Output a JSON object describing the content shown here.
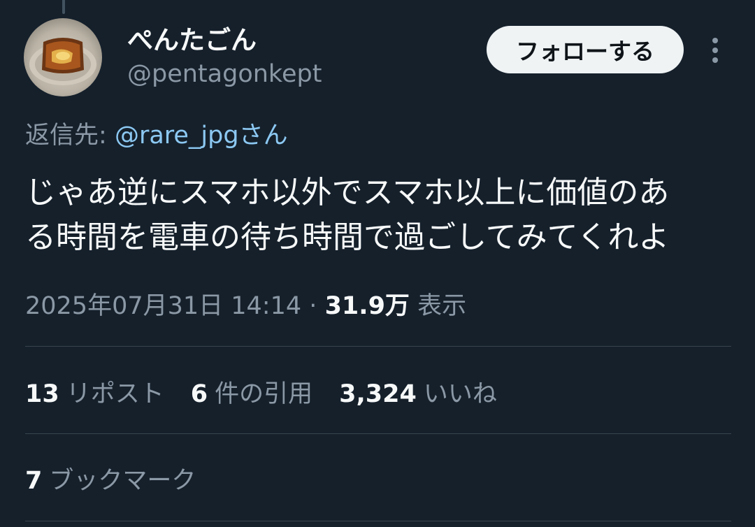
{
  "tweet": {
    "author": {
      "display_name": "ぺんたごん",
      "handle": "@pentagonkept",
      "avatar_icon": "toast-avatar-icon"
    },
    "follow_label": "フォローする",
    "more_icon": "more-vertical-icon",
    "reply_prefix": "返信先:",
    "reply_mention": "@rare_jpgさん",
    "text_lines": [
      "じゃあ逆にスマホ以外でスマホ以上に価値のあ",
      "る時間を電車の待ち時間で過ごしてみてくれよ"
    ],
    "date": "2025年07月31日 14:14",
    "separator": "·",
    "views_count": "31.9万",
    "views_label": "表示",
    "stats": {
      "reposts": {
        "count": "13",
        "label": "リポスト"
      },
      "quotes": {
        "count": "6",
        "label": "件の引用"
      },
      "likes": {
        "count": "3,324",
        "label": "いいね"
      }
    },
    "bookmarks": {
      "count": "7",
      "label": "ブックマーク"
    }
  },
  "colors": {
    "background": "#15202b",
    "primary_text": "#f7f9f9",
    "secondary_text": "#8b98a5",
    "link": "#8cc8f2",
    "divider": "#38444d",
    "follow_button_bg": "#eff3f4"
  }
}
